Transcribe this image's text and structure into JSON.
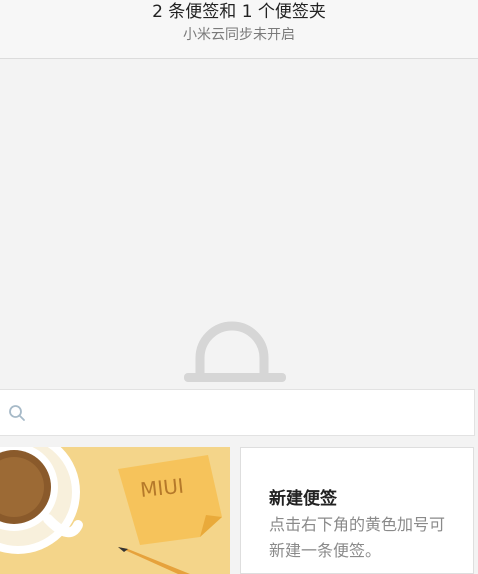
{
  "header": {
    "title": "2 条便签和 1 个便签夹",
    "subtitle": "小米云同步未开启"
  },
  "search": {
    "value": "",
    "placeholder": ""
  },
  "icons": {
    "pull": "pull-handle-icon",
    "search": "search-icon",
    "coffee": "coffee-cup-icon",
    "note": "sticky-note-icon",
    "pencil": "pencil-icon"
  },
  "cards": {
    "illustration_text": "MIUI",
    "new_note_title": "新建便签",
    "new_note_desc": "点击右下角的黄色加号可新建一条便签。"
  },
  "colors": {
    "accent_yellow": "#f4d58a",
    "note_yellow": "#f6c35b",
    "coffee": "#8a5a2b"
  }
}
